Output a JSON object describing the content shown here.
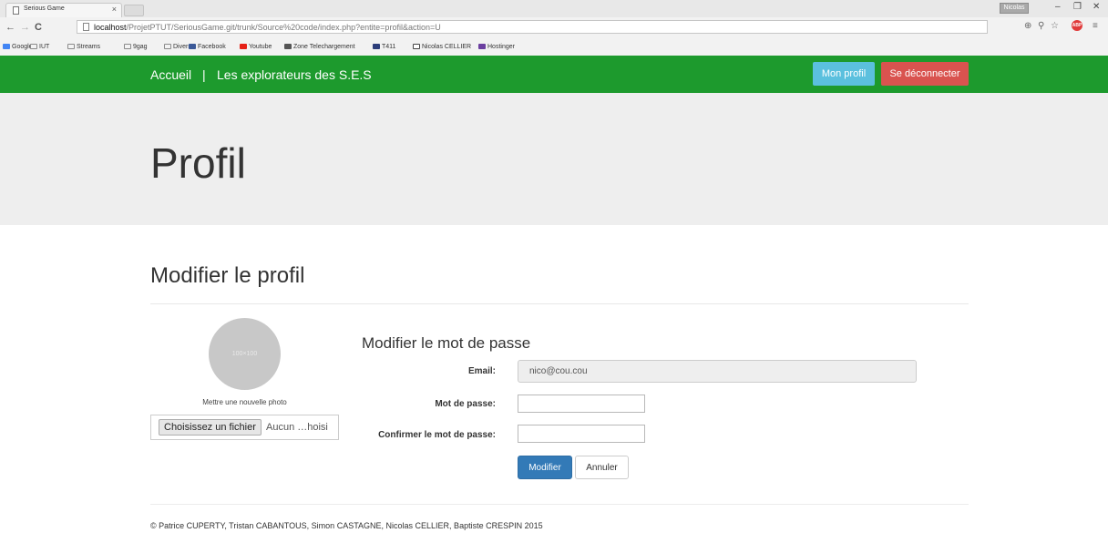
{
  "browser": {
    "tab_title": "Serious Game",
    "tab_close": "×",
    "profile_badge": "Nicolas",
    "url_host": "localhost",
    "url_path": "/ProjetPTUT/SeriousGame.git/trunk/Source%20code/index.php?entite=profil&action=U",
    "bookmarks": [
      {
        "label": "Google",
        "icon": "google-icon"
      },
      {
        "label": "IUT",
        "icon": "folder-icon"
      },
      {
        "label": "Streams",
        "icon": "folder-icon"
      },
      {
        "label": "9gag",
        "icon": "folder-icon"
      },
      {
        "label": "Divers",
        "icon": "folder-icon"
      },
      {
        "label": "Facebook",
        "icon": "facebook-icon"
      },
      {
        "label": "Youtube",
        "icon": "youtube-icon"
      },
      {
        "label": "Zone Telechargement",
        "icon": "zone-icon"
      },
      {
        "label": "T411",
        "icon": "t411-icon"
      },
      {
        "label": "Nicolas CELLIER",
        "icon": "monitor-icon"
      },
      {
        "label": "Hostinger",
        "icon": "hostinger-icon"
      }
    ]
  },
  "navbar": {
    "home": "Accueil",
    "separator": "|",
    "title": "Les explorateurs des S.E.S",
    "profile_button": "Mon profil",
    "logout_button": "Se déconnecter"
  },
  "jumbotron": {
    "title": "Profil"
  },
  "profile": {
    "section_title": "Modifier le profil",
    "avatar_placeholder": "100×100",
    "photo_label": "Mettre une nouvelle photo",
    "file_button": "Choisissez un fichier",
    "file_status": "Aucun …hoisi"
  },
  "password_form": {
    "title": "Modifier le mot de passe",
    "email_label": "Email:",
    "email_value": "nico@cou.cou",
    "password_label": "Mot de passe:",
    "confirm_label": "Confirmer le mot de passe:",
    "submit": "Modifier",
    "cancel": "Annuler"
  },
  "footer": {
    "text": "© Patrice CUPERTY, Tristan CABANTOUS, Simon CASTAGNE, Nicolas CELLIER, Baptiste CRESPIN 2015"
  },
  "colors": {
    "navbar": "#1d9a2d",
    "info": "#5bc0de",
    "danger": "#d9534f",
    "primary": "#337ab7",
    "jumbotron": "#eeeeee"
  }
}
